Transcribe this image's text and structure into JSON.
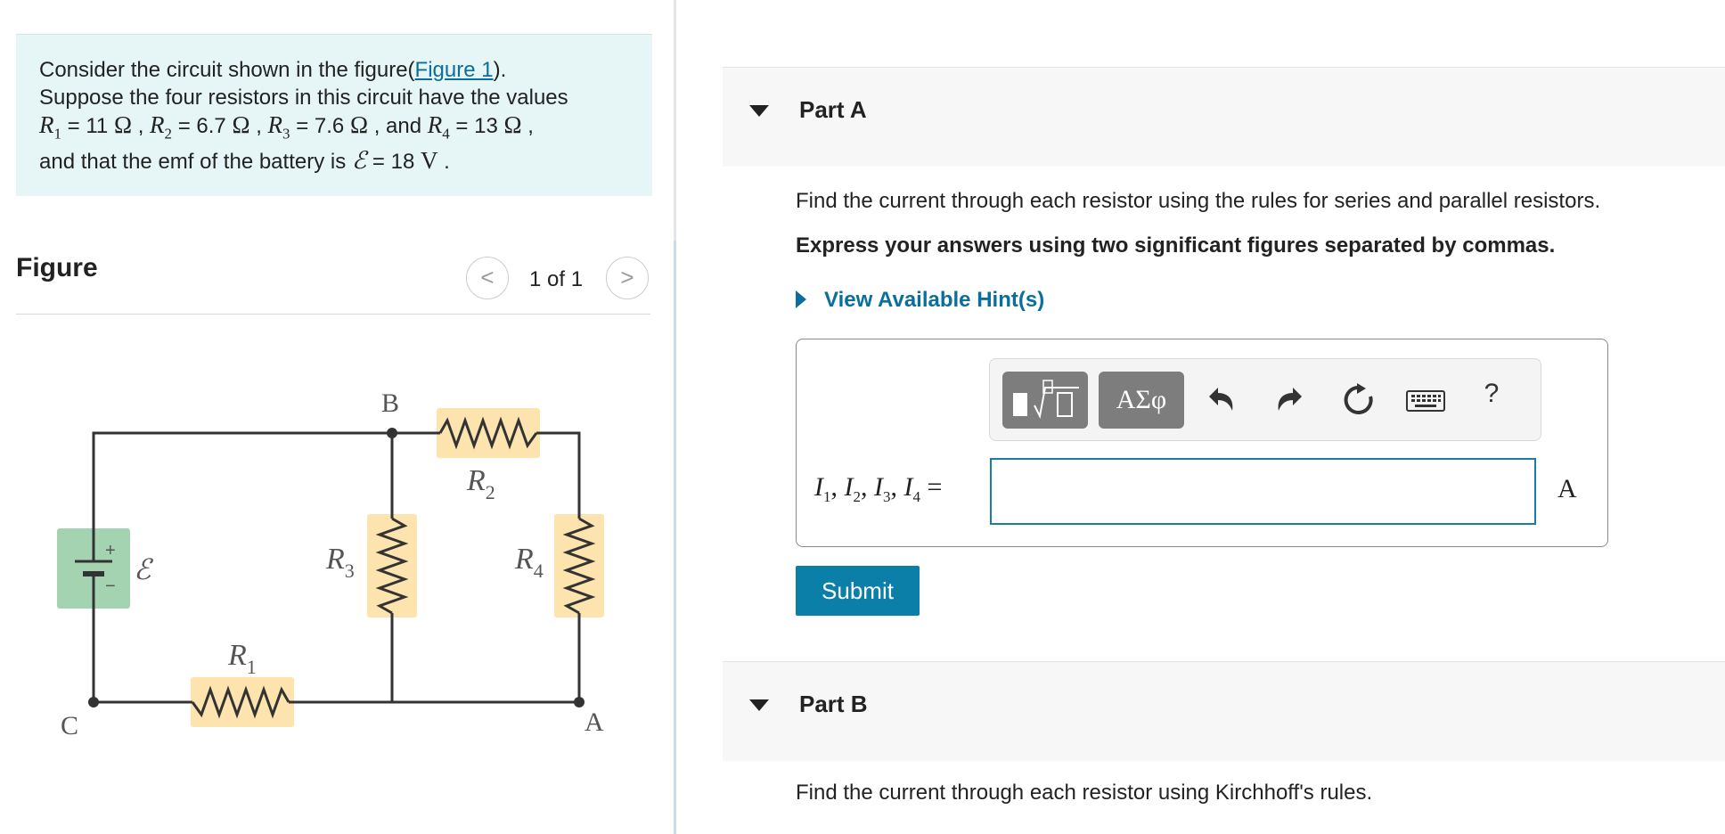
{
  "problem": {
    "line1_prefix": "Consider the circuit shown in the figure(",
    "figure_link": "Figure 1",
    "line1_suffix": ").",
    "line2": "Suppose the four resistors in this circuit have the values",
    "r1_symbol": "R",
    "r1_sub": "1",
    "r1_value": "11",
    "r2_symbol": "R",
    "r2_sub": "2",
    "r2_value": "6.7",
    "r3_symbol": "R",
    "r3_sub": "3",
    "r3_value": "7.6",
    "r4_symbol": "R",
    "r4_sub": "4",
    "r4_value": "13",
    "ohm": "Ω",
    "and_word": "and",
    "line4_prefix": "and that the emf of the battery is",
    "emf_symbol": "ℰ",
    "emf_value": "18",
    "volt": "V"
  },
  "figure": {
    "title": "Figure",
    "counter": "1 of 1",
    "prev_glyph": "<",
    "next_glyph": ">",
    "labels": {
      "B": "B",
      "C": "C",
      "A": "A",
      "plus": "+",
      "minus": "−",
      "emf": "ℰ",
      "R": "R",
      "sub1": "1",
      "sub2": "2",
      "sub3": "3",
      "sub4": "4"
    },
    "colors": {
      "battery": "#a3d3b0",
      "resistor": "#fde3ad",
      "wire": "#333333"
    }
  },
  "partA": {
    "title": "Part A",
    "instruction": "Find the current through each resistor using the rules for series and parallel resistors.",
    "format": "Express your answers using two significant figures separated by commas.",
    "hint_link": "View Available Hint(s)",
    "answer_label": {
      "I": "I",
      "s1": "1",
      "s2": "2",
      "s3": "3",
      "s4": "4",
      "comma": ", ",
      "equals": " ="
    },
    "answer_value": "",
    "unit": "A",
    "submit_label": "Submit",
    "toolbar": {
      "symbols_label": "ΑΣφ",
      "help_label": "?",
      "icons": [
        "template-icon",
        "undo-icon",
        "redo-icon",
        "reset-icon",
        "keyboard-icon"
      ]
    }
  },
  "partB": {
    "title": "Part B",
    "instruction": "Find the current through each resistor using Kirchhoff's rules."
  },
  "colors": {
    "accent": "#0b7fa8",
    "link": "#0a6f9c",
    "problem_bg": "#e6f5f6"
  }
}
